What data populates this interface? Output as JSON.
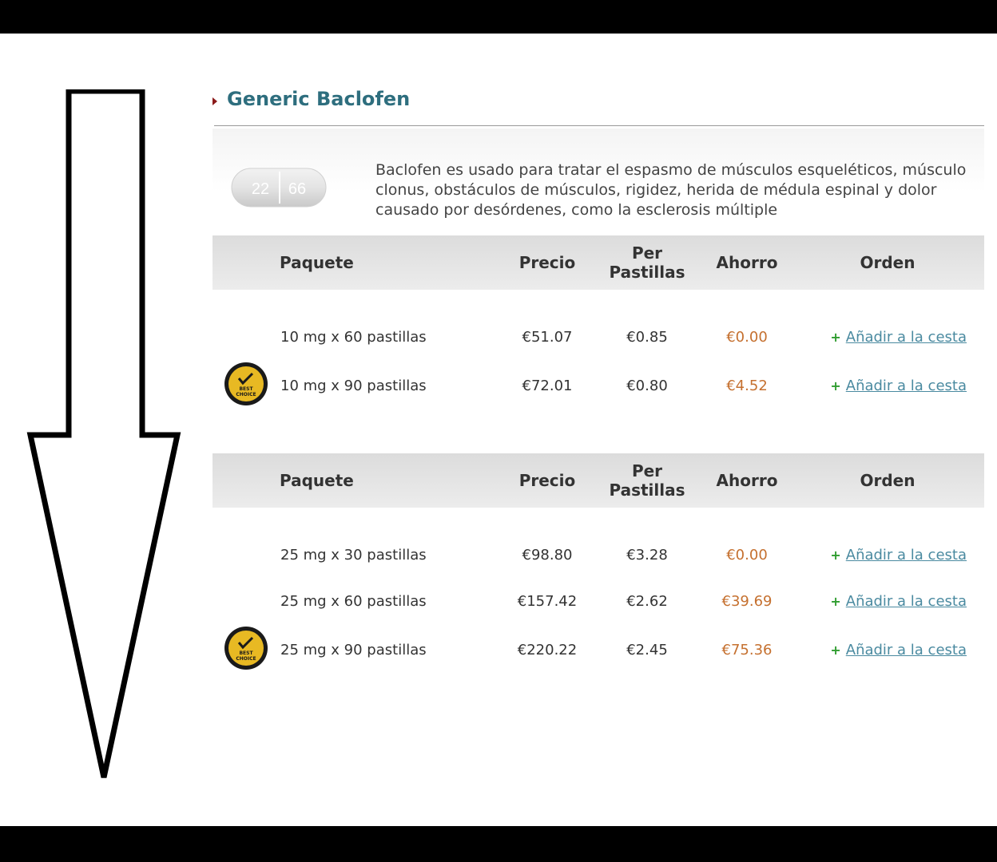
{
  "product": {
    "title": "Generic Baclofen",
    "description": "Baclofen es usado para tratar el espasmo de músculos esqueléticos, músculo clonus, obstáculos de músculos, rigidez, herida de médula espinal y dolor causado por desórdenes, como la esclerosis múltiple",
    "pill_imprint_left": "22",
    "pill_imprint_right": "66"
  },
  "table_headers": {
    "package": "Paquete",
    "price": "Precio",
    "per_pill": "Per Pastillas",
    "savings": "Ahorro",
    "order": "Orden"
  },
  "badge_text": "BEST CHOICE",
  "add_to_cart_label": "Añadir a la cesta",
  "groups": [
    {
      "rows": [
        {
          "package": "10 mg x 60 pastillas",
          "price": "€51.07",
          "per_pill": "€0.85",
          "savings": "€0.00",
          "best_choice": false
        },
        {
          "package": "10 mg x 90 pastillas",
          "price": "€72.01",
          "per_pill": "€0.80",
          "savings": "€4.52",
          "best_choice": true
        }
      ]
    },
    {
      "rows": [
        {
          "package": "25 mg x 30 pastillas",
          "price": "€98.80",
          "per_pill": "€3.28",
          "savings": "€0.00",
          "best_choice": false
        },
        {
          "package": "25 mg x 60 pastillas",
          "price": "€157.42",
          "per_pill": "€2.62",
          "savings": "€39.69",
          "best_choice": false
        },
        {
          "package": "25 mg x 90 pastillas",
          "price": "€220.22",
          "per_pill": "€2.45",
          "savings": "€75.36",
          "best_choice": true
        }
      ]
    }
  ],
  "colors": {
    "title": "#2e6e7e",
    "savings": "#c5702f",
    "link": "#4a8aa0",
    "plus": "#2f9c2f",
    "badge": "#e8b923"
  }
}
